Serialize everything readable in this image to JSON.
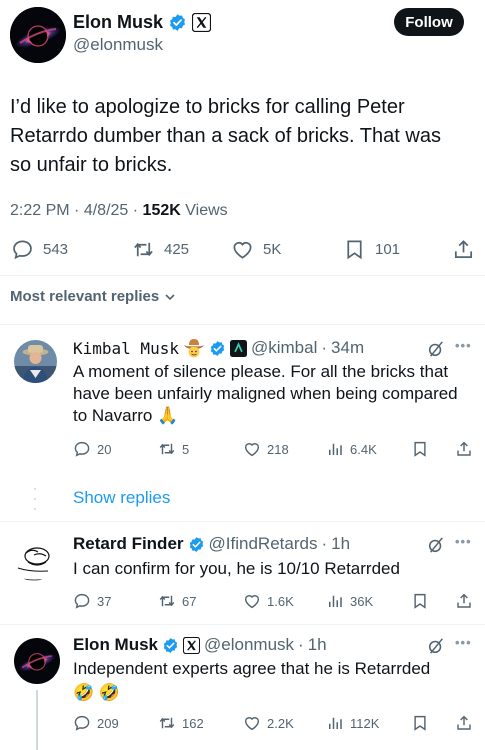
{
  "tweet": {
    "author": {
      "name": "Elon Musk",
      "handle": "@elonmusk"
    },
    "follow_label": "Follow",
    "text": "I’d like to apologize to bricks for calling Peter\nRetarrdo dumber than a sack of bricks. That was\nso unfair to bricks.",
    "time": "2:22 PM",
    "date": "4/8/25",
    "views_count": "152K",
    "views_label": "Views",
    "separator": "·",
    "actions": {
      "replies": "543",
      "reposts": "425",
      "likes": "5K",
      "bookmarks": "101"
    }
  },
  "sort_label": "Most relevant replies",
  "replies": [
    {
      "name": "Kimbal Musk",
      "handle": "@kimbal",
      "time": "34m",
      "text": "A moment of silence please. For all the bricks that have been unfairly maligned when being compared to Navarro",
      "emoji": "🙏",
      "actions": {
        "replies": "20",
        "reposts": "5",
        "likes": "218",
        "views": "6.4K"
      },
      "show_replies_label": "Show replies"
    },
    {
      "name": "Retard Finder",
      "handle": "@IfindRetards",
      "time": "1h",
      "text": "I can confirm for you, he is 10/10 Retarrded",
      "actions": {
        "replies": "37",
        "reposts": "67",
        "likes": "1.6K",
        "views": "36K"
      }
    },
    {
      "name": "Elon Musk",
      "handle": "@elonmusk",
      "time": "1h",
      "text": "Independent experts agree that he is Retarrded",
      "emoji": "🤣 🤣",
      "actions": {
        "replies": "209",
        "reposts": "162",
        "likes": "2.2K",
        "views": "112K"
      }
    }
  ],
  "colors": {
    "verified_badge": "#1d9bf0",
    "text_primary": "#0f1419",
    "text_secondary": "#536471",
    "link": "#1d9bf0",
    "divider": "#eff3f4",
    "follow_button_bg": "#0f1419"
  },
  "icons": {
    "verified": "verified-badge-icon",
    "x_affiliation": "x-logo-icon",
    "cowboy": "cowboy-emoji-icon",
    "affiliation_dark": "dark-app-badge-icon",
    "reply": "comment-bubble-icon",
    "repost": "repost-arrows-icon",
    "like": "heart-icon",
    "bookmark": "bookmark-icon",
    "share": "share-icon",
    "views": "bar-chart-icon",
    "grok": "grok-slash-icon",
    "more": "more-dots-icon"
  }
}
